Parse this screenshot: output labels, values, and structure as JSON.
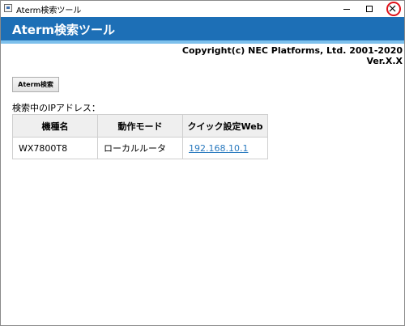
{
  "window": {
    "title": "Aterm検索ツール",
    "controls": [
      "minimize-icon",
      "maximize-icon",
      "close-icon"
    ]
  },
  "header": {
    "title": "Aterm検索ツール",
    "background": "#1d6fb6",
    "stripe_color": "#7dc0ec"
  },
  "copyright": {
    "text": "Copyright(c) NEC Platforms, Ltd. 2001-2020",
    "version": "Ver.X.X"
  },
  "toolbar": {
    "search_label": "Aterm検索"
  },
  "results": {
    "label": "検索中のIPアドレス：",
    "columns": [
      "機種名",
      "動作モード",
      "クイック設定Web"
    ],
    "rows": [
      {
        "model": "WX7800T8",
        "mode": "ローカルルータ",
        "web": "192.168.10.1"
      }
    ]
  },
  "accent": {
    "link": "#2a7abf",
    "close_highlight": "#e0121a"
  }
}
